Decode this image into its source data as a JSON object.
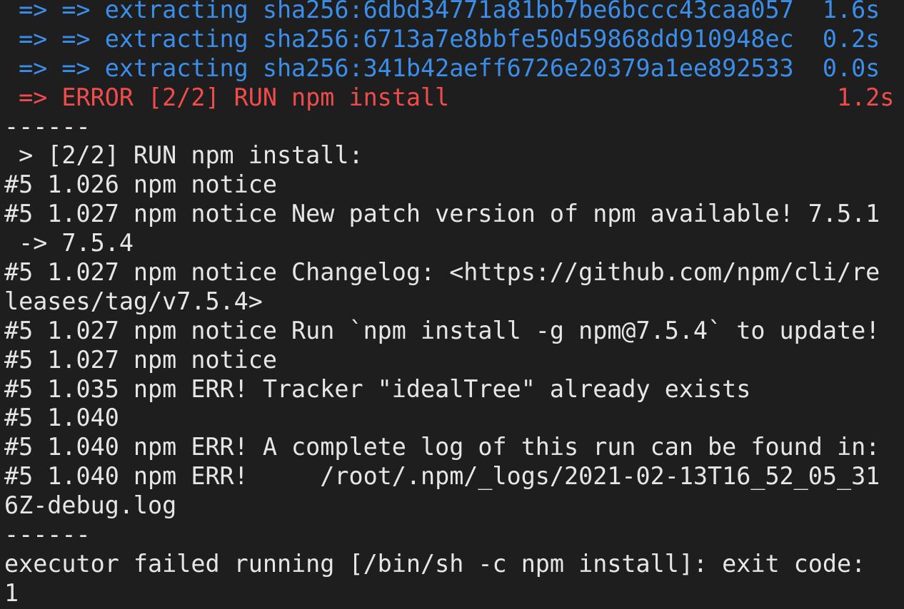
{
  "colors": {
    "background": "#1e1e1e",
    "text": "#e6e6e6",
    "progress_blue": "#3b8eea",
    "error_red": "#f14c4c"
  },
  "terminal": {
    "lines": [
      {
        "text": " => => extracting sha256:6dbd34771a81bb7be6bccc43caa057  1.6s",
        "color": "blue"
      },
      {
        "text": " => => extracting sha256:6713a7e8bbfe50d59868dd910948ec  0.2s",
        "color": "blue"
      },
      {
        "text": " => => extracting sha256:341b42aeff6726e20379a1ee892533  0.0s",
        "color": "blue"
      },
      {
        "text": " => ERROR [2/2] RUN npm install                           1.2s",
        "color": "red"
      },
      {
        "text": "------",
        "color": "white"
      },
      {
        "text": " > [2/2] RUN npm install:",
        "color": "white"
      },
      {
        "text": "#5 1.026 npm notice",
        "color": "white"
      },
      {
        "text": "#5 1.027 npm notice New patch version of npm available! 7.5.1",
        "color": "white"
      },
      {
        "text": " -> 7.5.4",
        "color": "white"
      },
      {
        "text": "#5 1.027 npm notice Changelog: <https://github.com/npm/cli/re",
        "color": "white"
      },
      {
        "text": "leases/tag/v7.5.4>",
        "color": "white"
      },
      {
        "text": "#5 1.027 npm notice Run `npm install -g npm@7.5.4` to update!",
        "color": "white"
      },
      {
        "text": "#5 1.027 npm notice",
        "color": "white"
      },
      {
        "text": "#5 1.035 npm ERR! Tracker \"idealTree\" already exists",
        "color": "white"
      },
      {
        "text": "#5 1.040",
        "color": "white"
      },
      {
        "text": "#5 1.040 npm ERR! A complete log of this run can be found in:",
        "color": "white"
      },
      {
        "text": "#5 1.040 npm ERR!     /root/.npm/_logs/2021-02-13T16_52_05_31",
        "color": "white"
      },
      {
        "text": "6Z-debug.log",
        "color": "white"
      },
      {
        "text": "------",
        "color": "white"
      },
      {
        "text": "executor failed running [/bin/sh -c npm install]: exit code:",
        "color": "white"
      },
      {
        "text": "1",
        "color": "white"
      }
    ]
  }
}
